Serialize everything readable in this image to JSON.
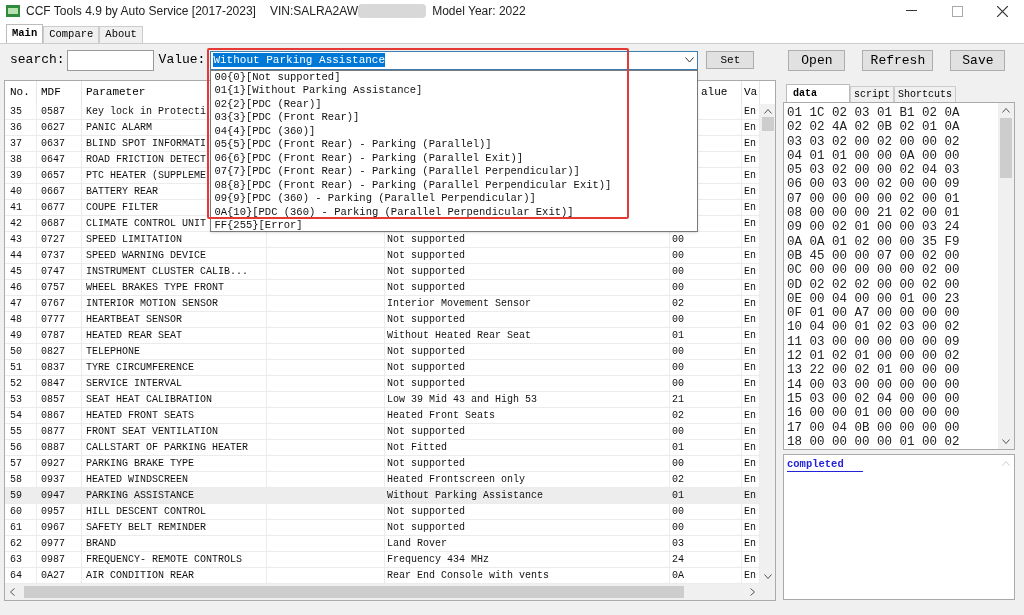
{
  "window": {
    "title": "CCF Tools 4.9 by Auto Service [2017-2023]",
    "vin": "VIN:SALRA2AW",
    "model_year": "Model Year: 2022"
  },
  "tabs": [
    {
      "label": "Main",
      "selected": true
    },
    {
      "label": "Compare",
      "selected": false
    },
    {
      "label": "About",
      "selected": false
    }
  ],
  "toolbar": {
    "search_label": "search:",
    "value_label": "Value:",
    "value": "Without Parking Assistance",
    "set_button": "Set",
    "buttons": [
      "Open",
      "Refresh",
      "Save"
    ]
  },
  "dropdown": {
    "options": [
      "00{0}[Not supported]",
      "01{1}[Without Parking Assistance]",
      "02{2}[PDC (Rear)]",
      "03{3}[PDC (Front Rear)]",
      "04{4}[PDC (360)]",
      "05{5}[PDC (Front Rear) - Parking (Parallel)]",
      "06{6}[PDC (Front Rear) - Parking (Parallel Exit)]",
      "07{7}[PDC (Front Rear) - Parking (Parallel Perpendicular)]",
      "08{8}[PDC (Front Rear) - Parking (Parallel Perpendicular Exit)]",
      "09{9}[PDC (360) - Parking (Parallel Perpendicular)]",
      "0A{10}[PDC (360) - Parking (Parallel Perpendicular Exit)]",
      "FF{255}[Error]"
    ]
  },
  "table": {
    "header": {
      "no": "No.",
      "mdf": "MDF",
      "parameter": "Parameter",
      "value": "alue",
      "column_6": "Va"
    },
    "rows": [
      {
        "no": "35",
        "mdf": "0587",
        "parameter": "Key lock in Protecti",
        "column_6": "En",
        "selected": false
      },
      {
        "no": "36",
        "mdf": "0627",
        "parameter": "PANIC ALARM",
        "column_6": "En",
        "selected": false
      },
      {
        "no": "37",
        "mdf": "0637",
        "parameter": "BLIND SPOT INFORMATI",
        "column_6": "En",
        "selected": false
      },
      {
        "no": "38",
        "mdf": "0647",
        "parameter": "ROAD FRICTION DETECT",
        "column_6": "En",
        "selected": false
      },
      {
        "no": "39",
        "mdf": "0657",
        "parameter": "PTC HEATER (SUPPLEME",
        "column_6": "En",
        "selected": false
      },
      {
        "no": "40",
        "mdf": "0667",
        "parameter": "BATTERY REAR",
        "column_6": "En",
        "selected": false
      },
      {
        "no": "41",
        "mdf": "0677",
        "parameter": "COUPE FILTER",
        "column_6": "En",
        "selected": false
      },
      {
        "no": "42",
        "mdf": "0687",
        "parameter": "CLIMATE CONTROL UNIT",
        "column_6": "En",
        "selected": false
      },
      {
        "no": "43",
        "mdf": "0727",
        "parameter": "SPEED LIMITATION",
        "description": "Not supported",
        "value": "00",
        "column_6": "En",
        "selected": false
      },
      {
        "no": "44",
        "mdf": "0737",
        "parameter": "SPEED WARNING DEVICE",
        "description": "Not supported",
        "value": "00",
        "column_6": "En",
        "selected": false
      },
      {
        "no": "45",
        "mdf": "0747",
        "parameter": "INSTRUMENT CLUSTER CALIB...",
        "description": "Not supported",
        "value": "00",
        "column_6": "En",
        "selected": false
      },
      {
        "no": "46",
        "mdf": "0757",
        "parameter": "WHEEL BRAKES TYPE FRONT",
        "description": "Not supported",
        "value": "00",
        "column_6": "En",
        "selected": false
      },
      {
        "no": "47",
        "mdf": "0767",
        "parameter": "INTERIOR MOTION SENSOR",
        "description": "Interior Movement Sensor",
        "value": "02",
        "column_6": "En",
        "selected": false
      },
      {
        "no": "48",
        "mdf": "0777",
        "parameter": "HEARTBEAT SENSOR",
        "description": "Not supported",
        "value": "00",
        "column_6": "En",
        "selected": false
      },
      {
        "no": "49",
        "mdf": "0787",
        "parameter": "HEATED REAR SEAT",
        "description": "Without Heated Rear Seat",
        "value": "01",
        "column_6": "En",
        "selected": false
      },
      {
        "no": "50",
        "mdf": "0827",
        "parameter": "TELEPHONE",
        "description": "Not supported",
        "value": "00",
        "column_6": "En",
        "selected": false
      },
      {
        "no": "51",
        "mdf": "0837",
        "parameter": "TYRE CIRCUMFERENCE",
        "description": "Not supported",
        "value": "00",
        "column_6": "En",
        "selected": false
      },
      {
        "no": "52",
        "mdf": "0847",
        "parameter": "SERVICE INTERVAL",
        "description": "Not supported",
        "value": "00",
        "column_6": "En",
        "selected": false
      },
      {
        "no": "53",
        "mdf": "0857",
        "parameter": "SEAT HEAT CALIBRATION",
        "description": "Low 39 Mid 43 and High 53",
        "value": "21",
        "column_6": "En",
        "selected": false
      },
      {
        "no": "54",
        "mdf": "0867",
        "parameter": "HEATED FRONT SEATS",
        "description": "Heated Front Seats",
        "value": "02",
        "column_6": "En",
        "selected": false
      },
      {
        "no": "55",
        "mdf": "0877",
        "parameter": "FRONT SEAT VENTILATION",
        "description": "Not supported",
        "value": "00",
        "column_6": "En",
        "selected": false
      },
      {
        "no": "56",
        "mdf": "0887",
        "parameter": "CALLSTART OF PARKING HEATER",
        "description": "Not Fitted",
        "value": "01",
        "column_6": "En",
        "selected": false
      },
      {
        "no": "57",
        "mdf": "0927",
        "parameter": "PARKING BRAKE TYPE",
        "description": "Not supported",
        "value": "00",
        "column_6": "En",
        "selected": false
      },
      {
        "no": "58",
        "mdf": "0937",
        "parameter": "HEATED WINDSCREEN",
        "description": "Heated Frontscreen only",
        "value": "02",
        "column_6": "En",
        "selected": false
      },
      {
        "no": "59",
        "mdf": "0947",
        "parameter": "PARKING ASSISTANCE",
        "description": "Without Parking Assistance",
        "value": "01",
        "column_6": "En",
        "selected": true
      },
      {
        "no": "60",
        "mdf": "0957",
        "parameter": "HILL DESCENT CONTROL",
        "description": "Not supported",
        "value": "00",
        "column_6": "En",
        "selected": false
      },
      {
        "no": "61",
        "mdf": "0967",
        "parameter": "SAFETY BELT REMINDER",
        "description": "Not supported",
        "value": "00",
        "column_6": "En",
        "selected": false
      },
      {
        "no": "62",
        "mdf": "0977",
        "parameter": "BRAND",
        "description": "Land Rover",
        "value": "03",
        "column_6": "En",
        "selected": false
      },
      {
        "no": "63",
        "mdf": "0987",
        "parameter": "FREQUENCY- REMOTE CONTROLS",
        "description": "Frequency 434 MHz",
        "value": "24",
        "column_6": "En",
        "selected": false
      },
      {
        "no": "64",
        "mdf": "0A27",
        "parameter": "AIR CONDITION REAR",
        "description": "Rear End Console with vents",
        "value": "0A",
        "column_6": "En",
        "selected": false
      }
    ]
  },
  "right_panel": {
    "tabs": [
      {
        "label": "data",
        "selected": true
      },
      {
        "label": "script",
        "selected": false
      },
      {
        "label": "Shortcuts",
        "selected": false
      }
    ],
    "hex_lines": [
      "01 1C 02 03 01 B1 02 0A",
      "02 02 4A 02 0B 02 01 0A",
      "03 03 02 00 02 00 00 02",
      "04 01 01 00 00 0A 00 00",
      "05 03 02 00 00 02 04 03",
      "06 00 03 00 02 00 00 09",
      "07 00 00 00 00 02 00 01",
      "08 00 00 00 21 02 00 01",
      "09 00 02 01 00 00 03 24",
      "0A 0A 01 02 00 00 35 F9",
      "0B 45 00 00 07 00 02 00",
      "0C 00 00 00 00 00 02 00",
      "0D 02 02 02 00 00 02 00",
      "0E 00 04 00 00 01 00 23",
      "0F 01 00 A7 00 00 00 00",
      "10 04 00 01 02 03 00 02",
      "11 03 00 00 00 00 00 09",
      "12 01 02 01 00 00 00 02",
      "13 22 00 02 01 00 00 00",
      "14 00 03 00 00 00 00 00",
      "15 03 00 02 04 00 00 00",
      "16 00 00 01 00 00 00 00",
      "17 00 04 0B 00 00 00 00",
      "18 00 00 00 00 01 00 02"
    ],
    "log": [
      "completed"
    ]
  }
}
